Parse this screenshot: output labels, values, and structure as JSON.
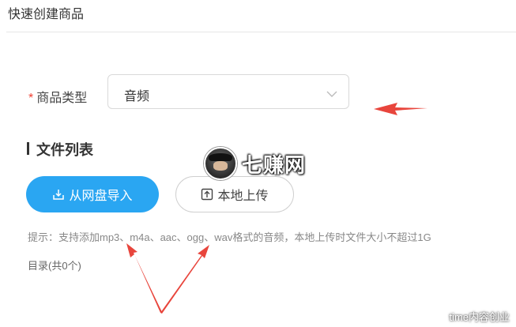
{
  "page": {
    "title": "快速创建商品"
  },
  "form": {
    "product_type": {
      "required_mark": "*",
      "label": "商品类型",
      "value": "音频"
    }
  },
  "file_list": {
    "section_title": "文件列表",
    "import_button_label": "从网盘导入",
    "upload_button_label": "本地上传",
    "hint": "提示：支持添加mp3、m4a、aac、ogg、wav格式的音频，本地上传时文件大小不超过1G",
    "directory_count": "目录(共0个)"
  },
  "watermarks": {
    "center_text": "七赚网",
    "corner_text": "time内容创业"
  },
  "colors": {
    "primary_button": "#2aa6f2",
    "annotation_arrow": "#e8453c",
    "required_mark": "#f04134"
  },
  "icons": {
    "select_arrow": "chevron-down-icon",
    "import": "download-box-icon",
    "upload": "upload-box-icon",
    "wechat": "wechat-icon"
  }
}
